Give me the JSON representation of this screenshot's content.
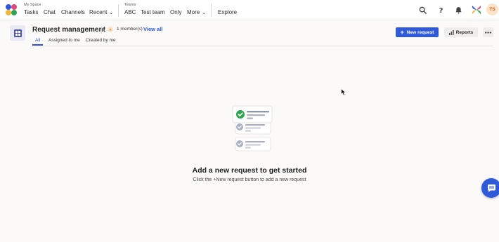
{
  "topnav": {
    "my_space_label": "My Space",
    "my_space_items": [
      {
        "label": "Tasks"
      },
      {
        "label": "Chat"
      },
      {
        "label": "Channels"
      },
      {
        "label": "Recent"
      }
    ],
    "teams_label": "Teams",
    "teams_items": [
      {
        "label": "ABC"
      },
      {
        "label": "Test team"
      },
      {
        "label": "Only"
      },
      {
        "label": "More"
      }
    ],
    "explore_label": "Explore",
    "avatar_initials": "TS"
  },
  "header": {
    "title": "Request management",
    "member_initial": "T",
    "member_count_text": "1 member(s)",
    "view_all_label": "View all",
    "new_request_label": "New request",
    "reports_label": "Reports"
  },
  "tabs": [
    {
      "label": "All",
      "active": true
    },
    {
      "label": "Assigned to me",
      "active": false
    },
    {
      "label": "Created by me",
      "active": false
    }
  ],
  "empty_state": {
    "title": "Add a new request to get started",
    "subtitle": "Click the +New request button to add a new request"
  },
  "colors": {
    "accent": "#2f5ad9",
    "check_green": "#2ea44f",
    "check_gray": "#9aa3b5"
  }
}
